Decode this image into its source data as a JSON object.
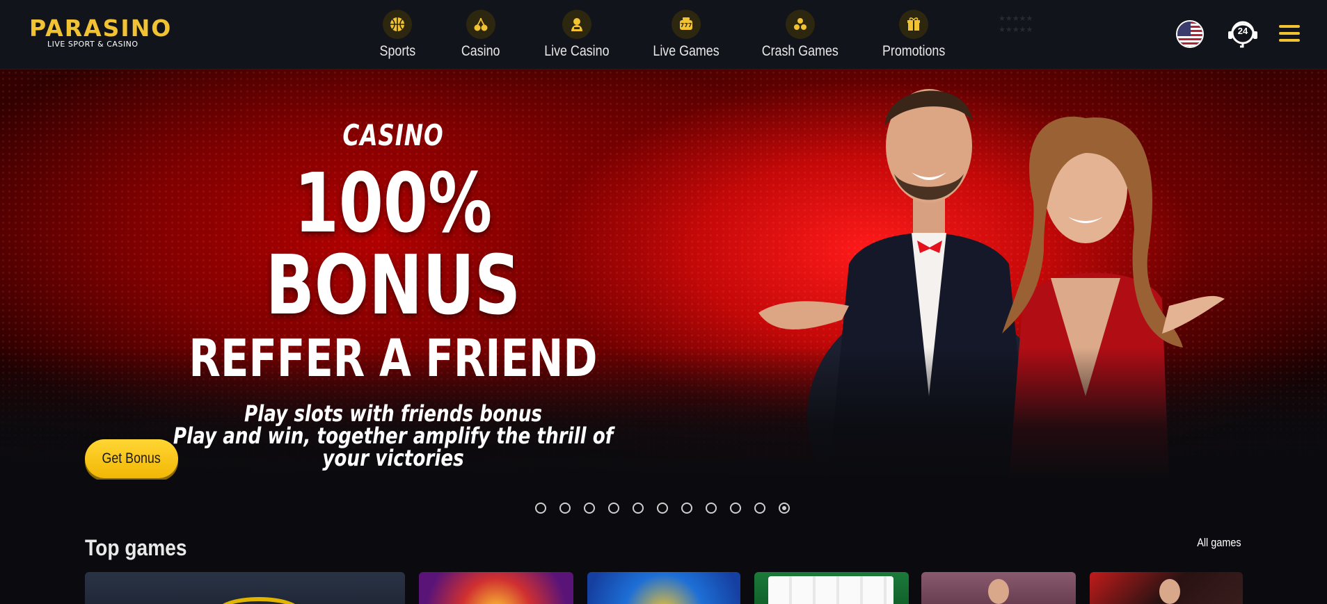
{
  "brand": {
    "name": "PARASINO",
    "tagline": "LIVE SPORT & CASINO"
  },
  "nav": [
    {
      "label": "Sports",
      "icon": "basketball-icon"
    },
    {
      "label": "Casino",
      "icon": "cherries-icon"
    },
    {
      "label": "Live Casino",
      "icon": "dealer-icon"
    },
    {
      "label": "Live Games",
      "icon": "slot-777-icon"
    },
    {
      "label": "Crash Games",
      "icon": "balls-icon"
    },
    {
      "label": "Promotions",
      "icon": "gift-icon"
    }
  ],
  "header_tools": {
    "language": "us-flag-icon",
    "support": "24h-support-icon",
    "menu": "hamburger-menu-icon",
    "support_label": "24"
  },
  "hero": {
    "tag": "CASINO",
    "title": "100% BONUS",
    "subtitle": "REFFER A FRIEND",
    "desc_line1": "Play slots with friends bonus",
    "desc_line2": "Play and win, together amplify the thrill of your victories",
    "cta": "Get Bonus"
  },
  "slider": {
    "count": 11,
    "active_index": 10
  },
  "top_games": {
    "title": "Top games",
    "all_link": "All games",
    "cards": [
      "game-card-1",
      "game-card-2",
      "game-card-3",
      "game-card-4",
      "game-card-5",
      "game-card-6"
    ]
  },
  "colors": {
    "accent": "#f1c232",
    "background": "#0b0b0f",
    "header": "#12141b",
    "hero_red": "#c40808"
  }
}
